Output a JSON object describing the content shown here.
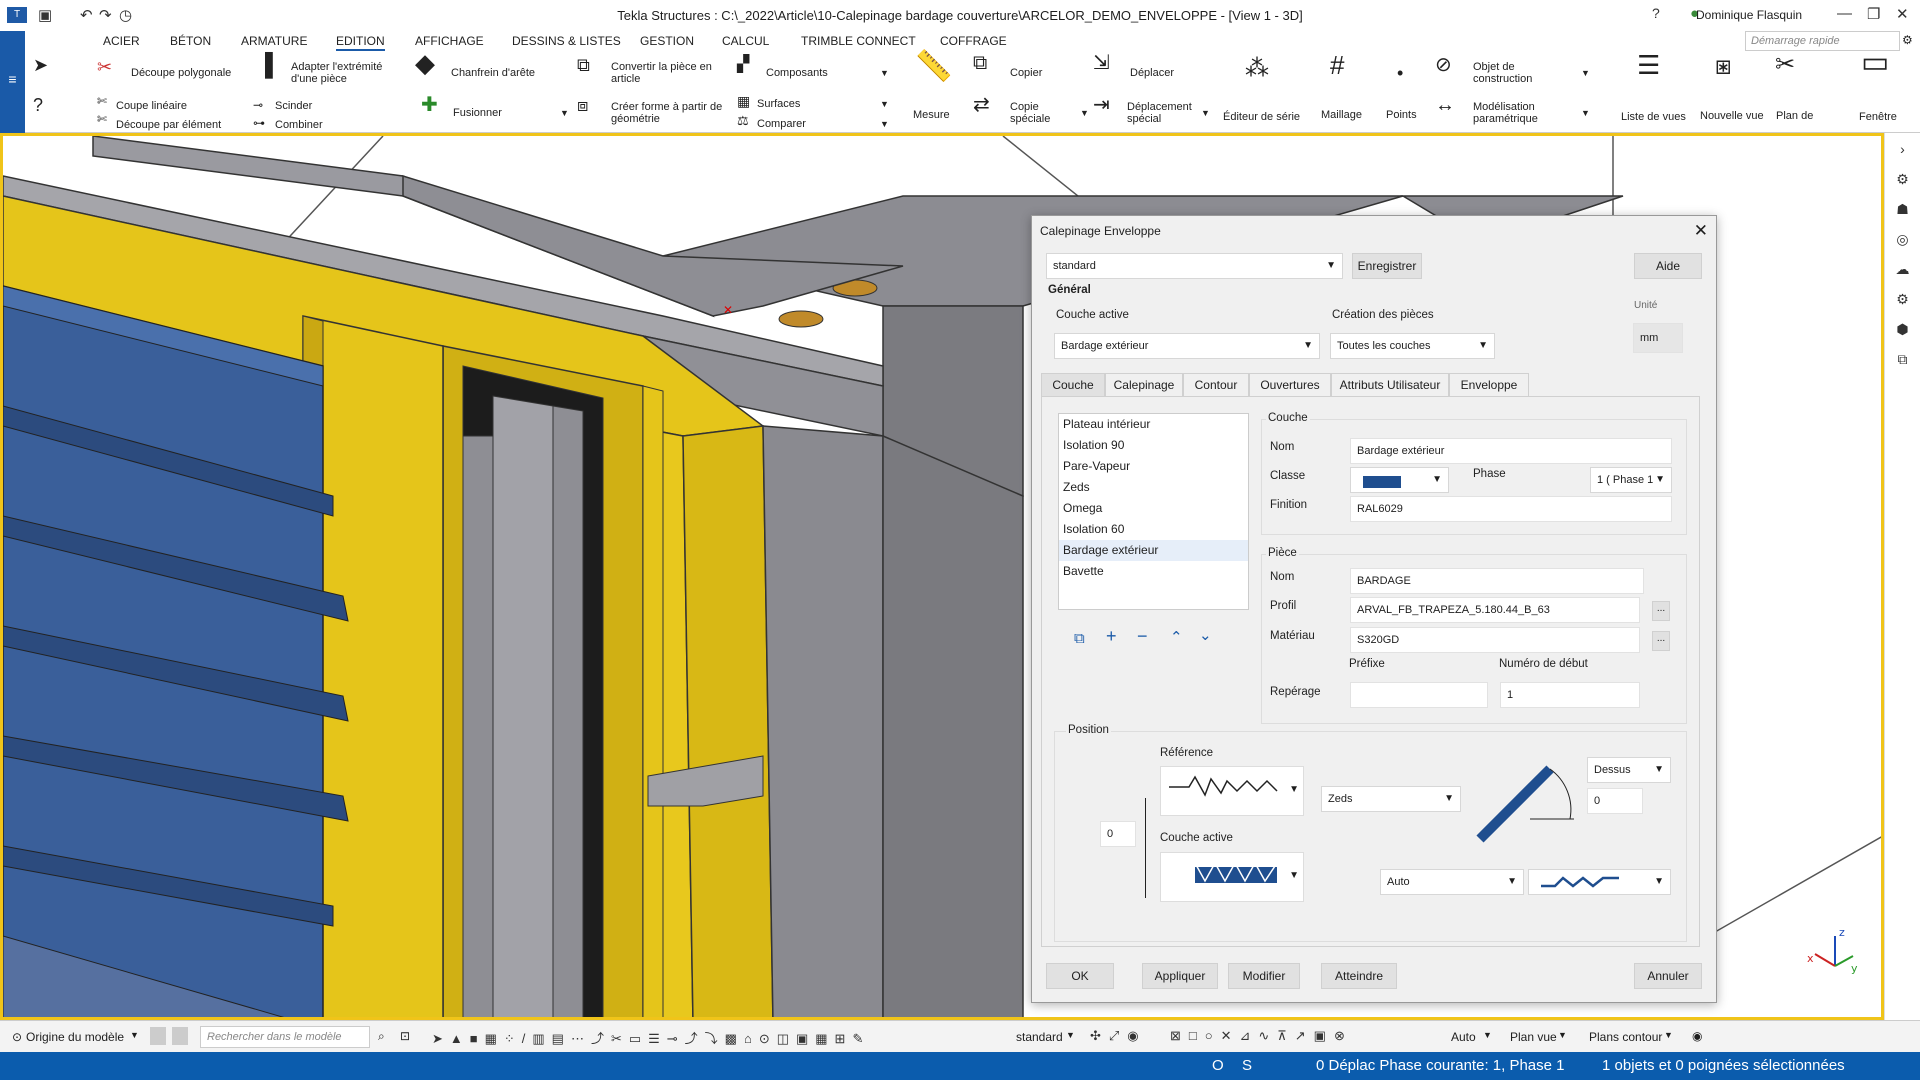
{
  "titlebar": {
    "title": "Tekla Structures : C:\\_2022\\Article\\10-Calepinage bardage couverture\\ARCELOR_DEMO_ENVELOPPE - [View 1 - 3D]",
    "user": "Dominique Flasquin",
    "quick_search_placeholder": "Démarrage rapide"
  },
  "menu": [
    "ACIER",
    "BÉTON",
    "ARMATURE",
    "EDITION",
    "AFFICHAGE",
    "DESSINS & LISTES",
    "GESTION",
    "CALCUL",
    "TRIMBLE CONNECT",
    "COFFRAGE"
  ],
  "ribbon": {
    "decoupe_polygonale": "Découpe polygonale",
    "adapter_extremite": "Adapter l'extrémité d'une pièce",
    "chanfrein_arete": "Chanfrein d'arête",
    "convertir_piece": "Convertir la pièce en article",
    "composants": "Composants",
    "copier": "Copier",
    "deplacer": "Déplacer",
    "objet_construction": "Objet de construction",
    "coupe_lineaire": "Coupe linéaire",
    "scinder": "Scinder",
    "fusionner": "Fusionner",
    "decoupe_par_element": "Découpe par élément",
    "combiner": "Combiner",
    "creer_forme": "Créer forme à partir de géométrie",
    "surfaces": "Surfaces",
    "comparer": "Comparer",
    "mesure": "Mesure",
    "copie_speciale": "Copie spéciale",
    "deplacement_special": "Déplacement spécial",
    "editeur_serie": "Éditeur de série",
    "maillage": "Maillage",
    "points": "Points",
    "modelisation_parametrique": "Modélisation paramétrique",
    "liste_vues": "Liste de vues",
    "nouvelle_vue": "Nouvelle vue",
    "plan_de": "Plan de",
    "fenetre": "Fenêtre"
  },
  "dialog": {
    "title": "Calepinage Enveloppe",
    "preset": "standard",
    "save_label": "Enregistrer",
    "help_label": "Aide",
    "general_label": "Général",
    "couche_active_label": "Couche active",
    "couche_active_value": "Bardage extérieur",
    "creation_pieces_label": "Création des pièces",
    "creation_pieces_value": "Toutes les couches",
    "unite_label": "Unité",
    "unite_value": "mm",
    "tabs": [
      "Couche",
      "Calepinage",
      "Contour",
      "Ouvertures",
      "Attributs Utilisateur",
      "Enveloppe"
    ],
    "layers": [
      "Plateau intérieur",
      "Isolation 90",
      "Pare-Vapeur",
      "Zeds",
      "Omega",
      "Isolation 60",
      "Bardage extérieur",
      "Bavette"
    ],
    "couche": {
      "group_label": "Couche",
      "nom_label": "Nom",
      "nom_value": "Bardage extérieur",
      "classe_label": "Classe",
      "classe_color": "#1f4e8f",
      "phase_label": "Phase",
      "phase_value": "1 ( Phase 1",
      "finition_label": "Finition",
      "finition_value": "RAL6029"
    },
    "piece": {
      "group_label": "Pièce",
      "nom_label": "Nom",
      "nom_value": "BARDAGE",
      "profil_label": "Profil",
      "profil_value": "ARVAL_FB_TRAPEZA_5.180.44_B_63",
      "materiau_label": "Matériau",
      "materiau_value": "S320GD",
      "prefixe_label": "Préfixe",
      "numero_debut_label": "Numéro de début",
      "reperage_label": "Repérage",
      "prefixe_value": "",
      "numero_debut_value": "1",
      "browse_label": "..."
    },
    "position": {
      "group_label": "Position",
      "reference_label": "Référence",
      "reference_layer": "Zeds",
      "couche_active_label": "Couche active",
      "offset_value": "0",
      "dessus_value": "Dessus",
      "dessus_offset": "0",
      "auto_value": "Auto"
    },
    "buttons": {
      "ok": "OK",
      "appliquer": "Appliquer",
      "modifier": "Modifier",
      "atteindre": "Atteindre",
      "annuler": "Annuler"
    }
  },
  "statusbar": {
    "origine": "Origine du modèle",
    "search_placeholder": "Rechercher dans le modèle",
    "standard": "standard",
    "auto": "Auto",
    "plan_vue": "Plan vue",
    "plans_contour": "Plans contour"
  },
  "bottombar": {
    "o": "O",
    "s": "S",
    "phase": "0 Déplac Phase courante: 1, Phase 1",
    "selection": "1 objets et 0 poignées sélectionnées"
  },
  "colors": {
    "accent": "#1a5aa8",
    "viewport_border": "#f0c419",
    "yellow_frame": "#e5c51a",
    "blue_cladding": "#3a5f9a",
    "grey_steel": "#8d8d93"
  }
}
